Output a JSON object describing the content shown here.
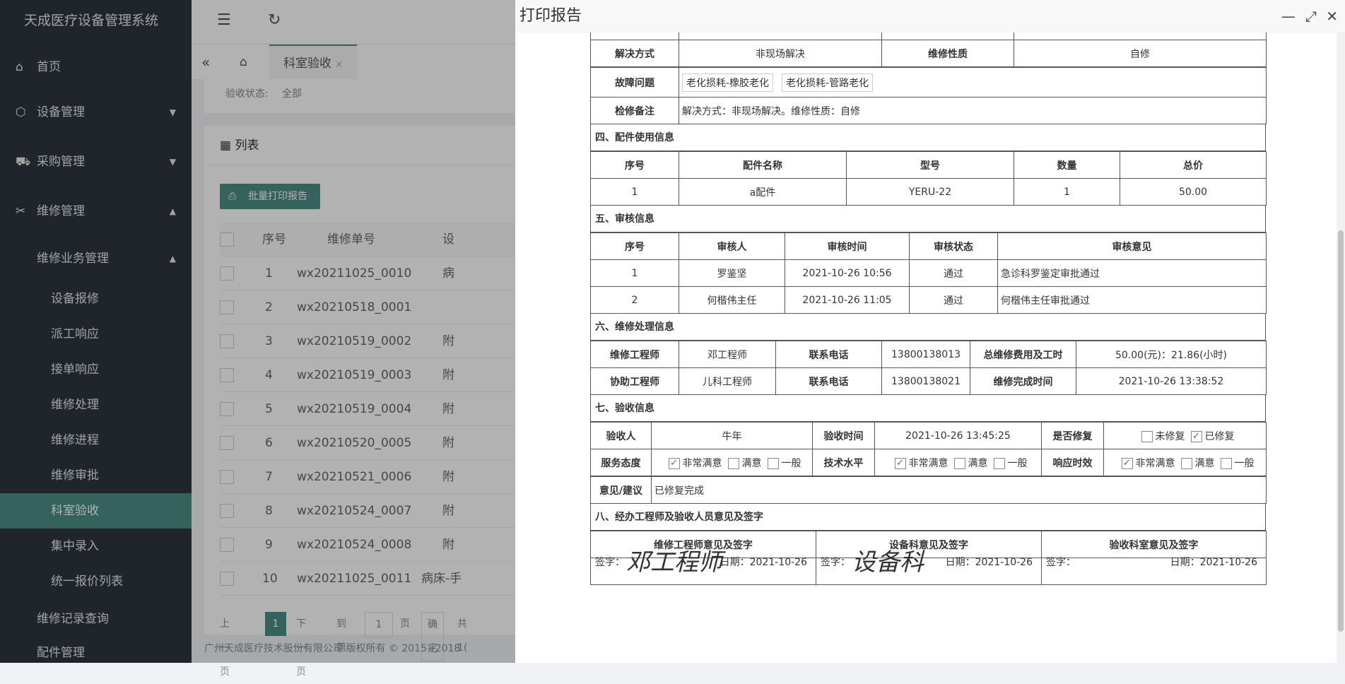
{
  "app": {
    "title": "天成医疗设备管理系统"
  },
  "sidebar": {
    "items": [
      {
        "label": "首页"
      },
      {
        "label": "设备管理"
      },
      {
        "label": "采购管理"
      },
      {
        "label": "维修管理"
      }
    ],
    "sub_group": "维修业务管理",
    "sub_items": [
      "设备报修",
      "派工响应",
      "接单响应",
      "维修处理",
      "维修进程",
      "维修审批",
      "科室验收",
      "集中录入",
      "统一报价列表"
    ],
    "after": [
      "维修记录查询",
      "配件管理"
    ]
  },
  "tabs": {
    "active": "科室验收"
  },
  "filter": {
    "label": "验收状态:",
    "value": "全部"
  },
  "list": {
    "title": "列表",
    "batch_print": "批量打印报告",
    "columns": [
      "序号",
      "维修单号",
      "设"
    ],
    "rows": [
      {
        "no": "1",
        "id": "wx20211025_0010",
        "extra": "病"
      },
      {
        "no": "2",
        "id": "wx20210518_0001",
        "extra": ""
      },
      {
        "no": "3",
        "id": "wx20210519_0002",
        "extra": "附"
      },
      {
        "no": "4",
        "id": "wx20210519_0003",
        "extra": "附"
      },
      {
        "no": "5",
        "id": "wx20210519_0004",
        "extra": "附"
      },
      {
        "no": "6",
        "id": "wx20210520_0005",
        "extra": "附"
      },
      {
        "no": "7",
        "id": "wx20210521_0006",
        "extra": "附"
      },
      {
        "no": "8",
        "id": "wx20210524_0007",
        "extra": "附"
      },
      {
        "no": "9",
        "id": "wx20210524_0008",
        "extra": "附"
      },
      {
        "no": "10",
        "id": "wx20211025_0011",
        "extra": "病床-手"
      }
    ],
    "pager": {
      "prev": "上一页",
      "page": "1",
      "next": "下一页",
      "goto": "到第",
      "page_input": "1",
      "page_unit": "页",
      "confirm": "确定",
      "total": "共 1("
    }
  },
  "footer": "广州天成医疗技术股份有限公司 版权所有 © 2015~2018",
  "modal": {
    "title": "打印报告",
    "resolve": {
      "method_label": "解决方式",
      "method": "非现场解决",
      "nature_label": "维修性质",
      "nature": "自修"
    },
    "fault": {
      "label": "故障问题",
      "tags": [
        "老化损耗-橡胶老化",
        "老化损耗-管路老化"
      ]
    },
    "remark": {
      "label": "检修备注",
      "value": "解决方式：非现场解决。维修性质：自修"
    },
    "parts": {
      "section": "四、配件使用信息",
      "headers": [
        "序号",
        "配件名称",
        "型号",
        "数量",
        "总价"
      ],
      "rows": [
        [
          "1",
          "a配件",
          "YERU-22",
          "1",
          "50.00"
        ]
      ]
    },
    "audit": {
      "section": "五、审核信息",
      "headers": [
        "序号",
        "审核人",
        "审核时间",
        "审核状态",
        "审核意见"
      ],
      "rows": [
        [
          "1",
          "罗鉴坚",
          "2021-10-26 10:56",
          "通过",
          "急诊科罗鉴定审批通过"
        ],
        [
          "2",
          "何楷伟主任",
          "2021-10-26 11:05",
          "通过",
          "何楷伟主任审批通过"
        ]
      ]
    },
    "repair": {
      "section": "六、维修处理信息",
      "engineer_label": "维修工程师",
      "engineer": "邓工程师",
      "phone_label": "联系电话",
      "phone1": "13800138013",
      "cost_label": "总维修费用及工时",
      "cost": "50.00(元)：21.86(小时)",
      "assist_label": "协助工程师",
      "assist": "儿科工程师",
      "phone2": "13800138021",
      "finish_label": "维修完成时间",
      "finish": "2021-10-26 13:38:52"
    },
    "accept": {
      "section": "七、验收信息",
      "person_label": "验收人",
      "person": "牛年",
      "time_label": "验收时间",
      "time": "2021-10-26 13:45:25",
      "fixed_label": "是否修复",
      "unfixed": "未修复",
      "fixed": "已修复",
      "service_label": "服务态度",
      "tech_label": "技术水平",
      "resp_label": "响应时效",
      "very": "非常满意",
      "ok": "满意",
      "normal": "一般",
      "advice_label": "意见/建议",
      "advice": "已修复完成"
    },
    "sign": {
      "section": "八、经办工程师及验收人员意见及签字",
      "headers": [
        "维修工程师意见及签字",
        "设备科意见及签字",
        "验收科室意见及签字"
      ],
      "sign_label": "签字：",
      "date_label1": "日期：2021-10-26",
      "date_label2": "日期：2021-10-26",
      "date_label3": "日期：2021-10-26",
      "sig1": "邓工程师",
      "sig2": "设备科"
    }
  }
}
